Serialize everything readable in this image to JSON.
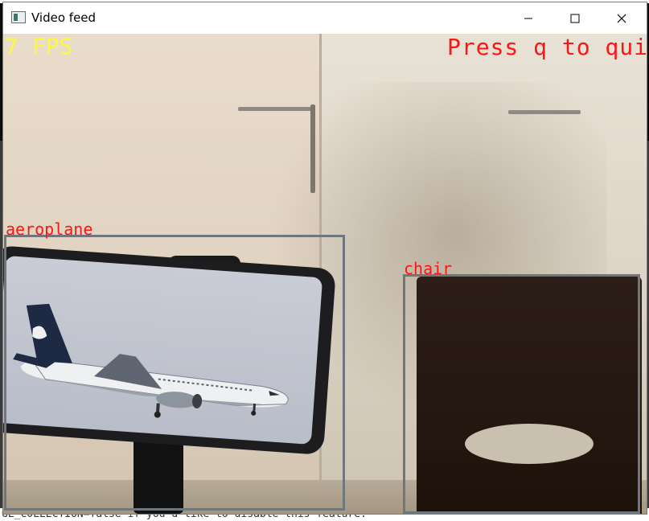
{
  "window": {
    "title": "Video feed",
    "minimize_icon": "minimize-icon",
    "maximize_icon": "maximize-icon",
    "close_icon": "close-icon"
  },
  "overlay": {
    "fps_text": "7 FPS",
    "quit_hint": "Press q to quit"
  },
  "detections": [
    {
      "label": "aeroplane",
      "box_color": "#6f777c",
      "label_color": "#ff1414"
    },
    {
      "label": "chair",
      "box_color": "#6f777c",
      "label_color": "#ff1414"
    }
  ],
  "console": {
    "bottom_line": "GE_COLLECTION=false if you'd like to disable this feature."
  },
  "colors": {
    "fps_color": "#ffff24",
    "quit_color": "#ff1414"
  }
}
